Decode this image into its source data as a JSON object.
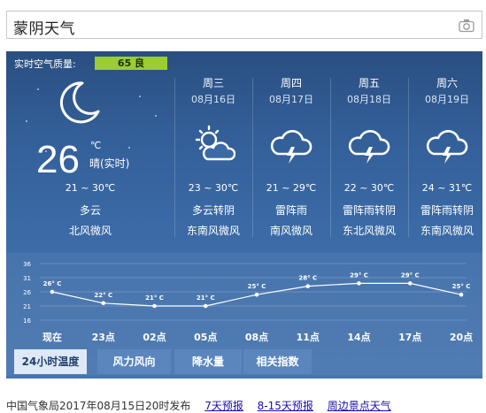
{
  "search": {
    "query": "蒙阴天气"
  },
  "air_quality": {
    "label": "实时空气质量:",
    "value": "65 良",
    "color": "#9acd32"
  },
  "today": {
    "temp": "26",
    "unit": "℃",
    "now": "晴(实时)",
    "range": "21 ~ 30℃",
    "condition": "多云",
    "wind": "北风微风",
    "icon": "crescent-moon-icon"
  },
  "days": [
    {
      "name": "周三",
      "date": "08月16日",
      "range": "23 ~ 30℃",
      "condition": "多云转阴",
      "wind": "东南风微风",
      "icon": "partly-cloudy-icon"
    },
    {
      "name": "周四",
      "date": "08月17日",
      "range": "21 ~ 29℃",
      "condition": "雷阵雨",
      "wind": "南风微风",
      "icon": "thunderstorm-icon"
    },
    {
      "name": "周五",
      "date": "08月18日",
      "range": "22 ~ 30℃",
      "condition": "雷阵雨转阴",
      "wind": "东北风微风",
      "icon": "thunderstorm-icon"
    },
    {
      "name": "周六",
      "date": "08月19日",
      "range": "24 ~ 31℃",
      "condition": "雷阵雨转阴",
      "wind": "东南风微风",
      "icon": "thunderstorm-icon"
    }
  ],
  "chart_data": {
    "type": "line",
    "categories": [
      "现在",
      "23点",
      "02点",
      "05点",
      "08点",
      "11点",
      "14点",
      "17点",
      "20点"
    ],
    "series": [
      {
        "values": [
          26,
          22,
          21,
          21,
          25,
          28,
          29,
          29,
          25
        ]
      }
    ],
    "data_labels": [
      "26° C",
      "22° C",
      "21° C",
      "21° C",
      "25° C",
      "28° C",
      "29° C",
      "29° C",
      "25° C"
    ],
    "y_ticks": [
      "36",
      "31",
      "26",
      "21",
      "16"
    ],
    "ylim": [
      16,
      36
    ],
    "grid": true
  },
  "tabs": [
    "24小时温度",
    "风力风向",
    "降水量",
    "相关指数"
  ],
  "active_tab": "24小时温度",
  "footer": {
    "publish": "中国气象局2017年08月15日20时发布",
    "links": [
      "7天预报",
      "8-15天预报",
      "周边景点天气"
    ]
  }
}
